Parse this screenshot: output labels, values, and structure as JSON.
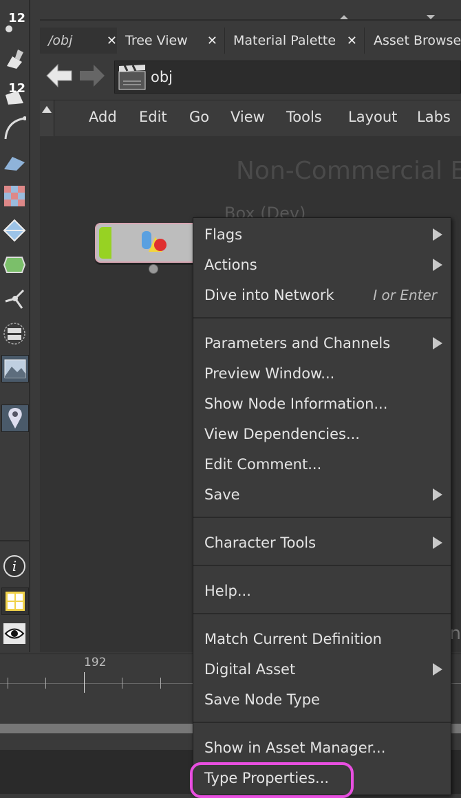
{
  "toolbar": {
    "badge_1": "12",
    "badge_2": "12"
  },
  "tabs": [
    {
      "label": "/obj",
      "close": "✕"
    },
    {
      "label": "Tree View",
      "close": "✕"
    },
    {
      "label": "Material Palette",
      "close": "✕"
    },
    {
      "label": "Asset Browser",
      "close": ""
    }
  ],
  "path": {
    "value": "obj"
  },
  "menubar": {
    "items": [
      "Add",
      "Edit",
      "Go",
      "View",
      "Tools",
      "Layout",
      "Labs"
    ]
  },
  "network": {
    "watermark": "Non-Commercial E",
    "node_label": "Box (Dev)",
    "partial_text": "n"
  },
  "timeline": {
    "frame": "192"
  },
  "context_menu": {
    "items": [
      {
        "label": "Flags",
        "submenu": true
      },
      {
        "label": "Actions",
        "submenu": true
      },
      {
        "label": "Dive into Network",
        "shortcut": "I or Enter"
      },
      {
        "label": "Parameters and Channels",
        "submenu": true
      },
      {
        "label": "Preview Window..."
      },
      {
        "label": "Show Node Information..."
      },
      {
        "label": "View Dependencies..."
      },
      {
        "label": "Edit Comment..."
      },
      {
        "label": "Save",
        "submenu": true
      },
      {
        "label": "Character Tools",
        "submenu": true
      },
      {
        "label": "Help..."
      },
      {
        "label": "Match Current Definition"
      },
      {
        "label": "Digital Asset",
        "submenu": true
      },
      {
        "label": "Save Node Type"
      },
      {
        "label": "Show in Asset Manager..."
      },
      {
        "label": "Type Properties..."
      }
    ]
  },
  "colors": {
    "node_flag": "#97d223",
    "highlight": "#e84fe0"
  }
}
